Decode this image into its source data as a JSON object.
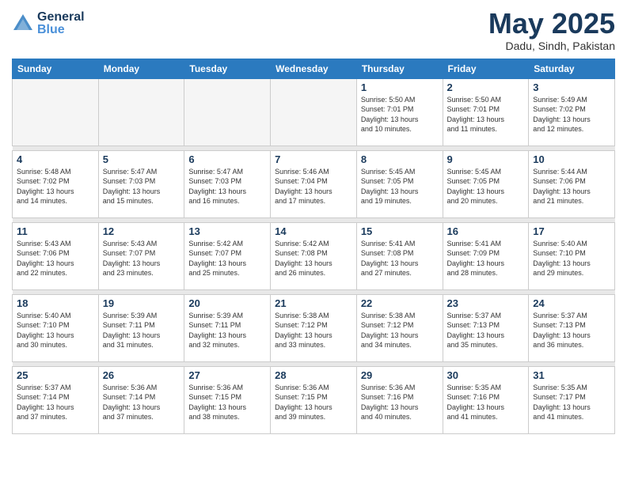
{
  "header": {
    "logo_general": "General",
    "logo_blue": "Blue",
    "title": "May 2025",
    "subtitle": "Dadu, Sindh, Pakistan"
  },
  "weekdays": [
    "Sunday",
    "Monday",
    "Tuesday",
    "Wednesday",
    "Thursday",
    "Friday",
    "Saturday"
  ],
  "weeks": [
    [
      {
        "day": "",
        "info": ""
      },
      {
        "day": "",
        "info": ""
      },
      {
        "day": "",
        "info": ""
      },
      {
        "day": "",
        "info": ""
      },
      {
        "day": "1",
        "info": "Sunrise: 5:50 AM\nSunset: 7:01 PM\nDaylight: 13 hours\nand 10 minutes."
      },
      {
        "day": "2",
        "info": "Sunrise: 5:50 AM\nSunset: 7:01 PM\nDaylight: 13 hours\nand 11 minutes."
      },
      {
        "day": "3",
        "info": "Sunrise: 5:49 AM\nSunset: 7:02 PM\nDaylight: 13 hours\nand 12 minutes."
      }
    ],
    [
      {
        "day": "4",
        "info": "Sunrise: 5:48 AM\nSunset: 7:02 PM\nDaylight: 13 hours\nand 14 minutes."
      },
      {
        "day": "5",
        "info": "Sunrise: 5:47 AM\nSunset: 7:03 PM\nDaylight: 13 hours\nand 15 minutes."
      },
      {
        "day": "6",
        "info": "Sunrise: 5:47 AM\nSunset: 7:03 PM\nDaylight: 13 hours\nand 16 minutes."
      },
      {
        "day": "7",
        "info": "Sunrise: 5:46 AM\nSunset: 7:04 PM\nDaylight: 13 hours\nand 17 minutes."
      },
      {
        "day": "8",
        "info": "Sunrise: 5:45 AM\nSunset: 7:05 PM\nDaylight: 13 hours\nand 19 minutes."
      },
      {
        "day": "9",
        "info": "Sunrise: 5:45 AM\nSunset: 7:05 PM\nDaylight: 13 hours\nand 20 minutes."
      },
      {
        "day": "10",
        "info": "Sunrise: 5:44 AM\nSunset: 7:06 PM\nDaylight: 13 hours\nand 21 minutes."
      }
    ],
    [
      {
        "day": "11",
        "info": "Sunrise: 5:43 AM\nSunset: 7:06 PM\nDaylight: 13 hours\nand 22 minutes."
      },
      {
        "day": "12",
        "info": "Sunrise: 5:43 AM\nSunset: 7:07 PM\nDaylight: 13 hours\nand 23 minutes."
      },
      {
        "day": "13",
        "info": "Sunrise: 5:42 AM\nSunset: 7:07 PM\nDaylight: 13 hours\nand 25 minutes."
      },
      {
        "day": "14",
        "info": "Sunrise: 5:42 AM\nSunset: 7:08 PM\nDaylight: 13 hours\nand 26 minutes."
      },
      {
        "day": "15",
        "info": "Sunrise: 5:41 AM\nSunset: 7:08 PM\nDaylight: 13 hours\nand 27 minutes."
      },
      {
        "day": "16",
        "info": "Sunrise: 5:41 AM\nSunset: 7:09 PM\nDaylight: 13 hours\nand 28 minutes."
      },
      {
        "day": "17",
        "info": "Sunrise: 5:40 AM\nSunset: 7:10 PM\nDaylight: 13 hours\nand 29 minutes."
      }
    ],
    [
      {
        "day": "18",
        "info": "Sunrise: 5:40 AM\nSunset: 7:10 PM\nDaylight: 13 hours\nand 30 minutes."
      },
      {
        "day": "19",
        "info": "Sunrise: 5:39 AM\nSunset: 7:11 PM\nDaylight: 13 hours\nand 31 minutes."
      },
      {
        "day": "20",
        "info": "Sunrise: 5:39 AM\nSunset: 7:11 PM\nDaylight: 13 hours\nand 32 minutes."
      },
      {
        "day": "21",
        "info": "Sunrise: 5:38 AM\nSunset: 7:12 PM\nDaylight: 13 hours\nand 33 minutes."
      },
      {
        "day": "22",
        "info": "Sunrise: 5:38 AM\nSunset: 7:12 PM\nDaylight: 13 hours\nand 34 minutes."
      },
      {
        "day": "23",
        "info": "Sunrise: 5:37 AM\nSunset: 7:13 PM\nDaylight: 13 hours\nand 35 minutes."
      },
      {
        "day": "24",
        "info": "Sunrise: 5:37 AM\nSunset: 7:13 PM\nDaylight: 13 hours\nand 36 minutes."
      }
    ],
    [
      {
        "day": "25",
        "info": "Sunrise: 5:37 AM\nSunset: 7:14 PM\nDaylight: 13 hours\nand 37 minutes."
      },
      {
        "day": "26",
        "info": "Sunrise: 5:36 AM\nSunset: 7:14 PM\nDaylight: 13 hours\nand 37 minutes."
      },
      {
        "day": "27",
        "info": "Sunrise: 5:36 AM\nSunset: 7:15 PM\nDaylight: 13 hours\nand 38 minutes."
      },
      {
        "day": "28",
        "info": "Sunrise: 5:36 AM\nSunset: 7:15 PM\nDaylight: 13 hours\nand 39 minutes."
      },
      {
        "day": "29",
        "info": "Sunrise: 5:36 AM\nSunset: 7:16 PM\nDaylight: 13 hours\nand 40 minutes."
      },
      {
        "day": "30",
        "info": "Sunrise: 5:35 AM\nSunset: 7:16 PM\nDaylight: 13 hours\nand 41 minutes."
      },
      {
        "day": "31",
        "info": "Sunrise: 5:35 AM\nSunset: 7:17 PM\nDaylight: 13 hours\nand 41 minutes."
      }
    ]
  ]
}
